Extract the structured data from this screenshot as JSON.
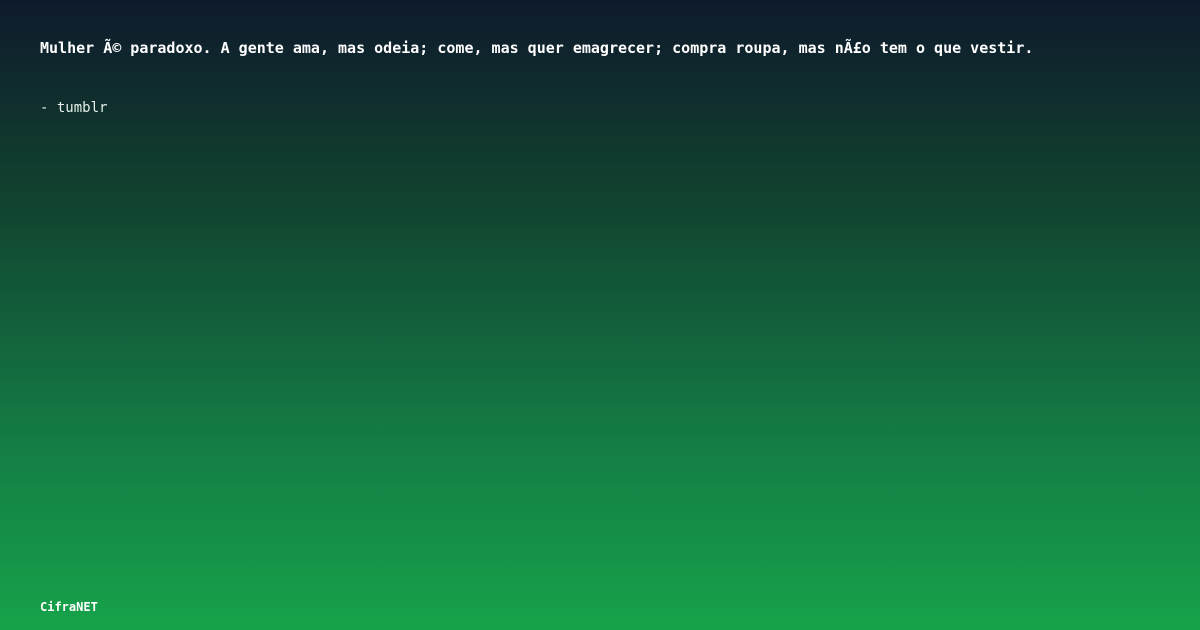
{
  "quote": {
    "text": "Mulher Ã© paradoxo. A gente ama, mas odeia; come, mas quer emagrecer; compra roupa, mas nÃ£o tem o que vestir.",
    "author": "- tumblr"
  },
  "brand": {
    "name": "CifraNET"
  },
  "colors": {
    "background_top": "#0e1a2c",
    "background_bottom": "#16a34a",
    "text": "#ffffff"
  }
}
